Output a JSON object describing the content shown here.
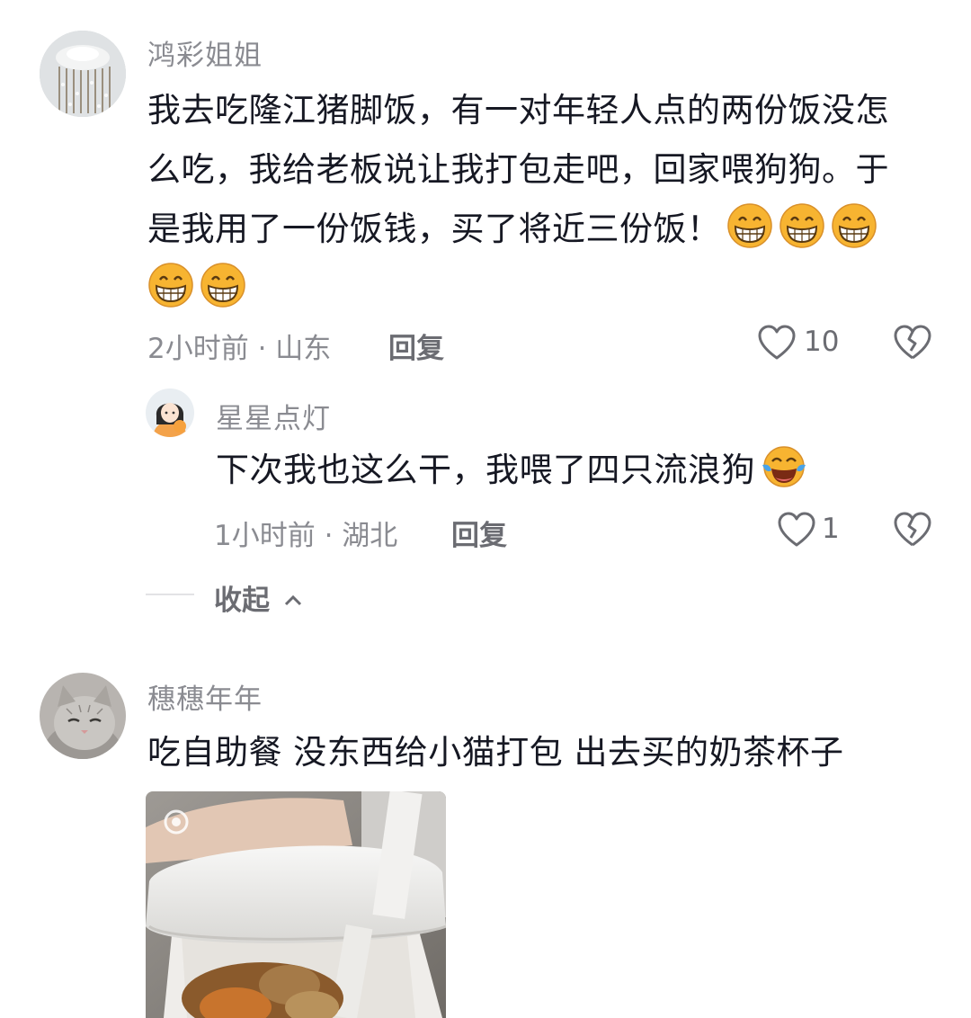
{
  "comments": [
    {
      "username": "鸿彩姐姐",
      "text_line1": "我去吃隆江猪脚饭，有一对年轻人点的两份饭没怎",
      "text_line2": "么吃，我给老板说让我打包走吧，回家喂狗狗。于",
      "text_line3": "是我用了一份饭钱，买了将近三份饭！",
      "emojis": [
        "grin-icon",
        "grin-icon",
        "grin-icon",
        "grin-icon",
        "grin-icon"
      ],
      "meta": "2小时前 · 山东",
      "reply_label": "回复",
      "likes": "10",
      "reply": {
        "username": "星星点灯",
        "text": "下次我也这么干，我喂了四只流浪狗",
        "emoji": "tears-of-joy-icon",
        "meta": "1小时前 · 湖北",
        "reply_label": "回复",
        "likes": "1"
      },
      "collapse_label": "收起"
    },
    {
      "username": "穗穗年年",
      "text": "吃自助餐 没东西给小猫打包 出去买的奶茶杯子"
    }
  ],
  "colors": {
    "text": "#161823",
    "muted": "#8a8b91",
    "emoji": "#f7b431"
  }
}
